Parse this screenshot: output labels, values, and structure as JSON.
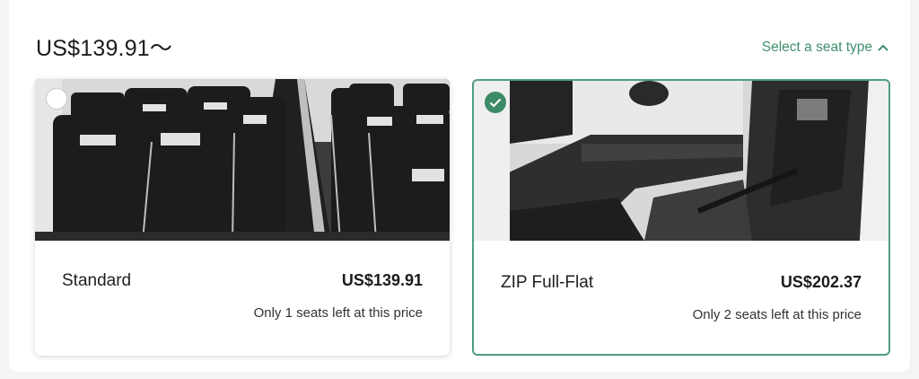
{
  "header": {
    "price_from": "US$139.91～",
    "seat_type_toggle_label": "Select a seat type"
  },
  "options": [
    {
      "name": "Standard",
      "price": "US$139.91",
      "availability": "Only 1 seats left at this price",
      "selected": false
    },
    {
      "name": "ZIP Full-Flat",
      "price": "US$202.37",
      "availability": "Only 2 seats left at this price",
      "selected": true
    }
  ],
  "icons": {
    "toggle": "chevron-up-icon",
    "selected": "checkmark-icon",
    "unselected": "radio-icon"
  },
  "colors": {
    "accent": "#3f8f6b",
    "selected_border": "#4f9d7c"
  }
}
